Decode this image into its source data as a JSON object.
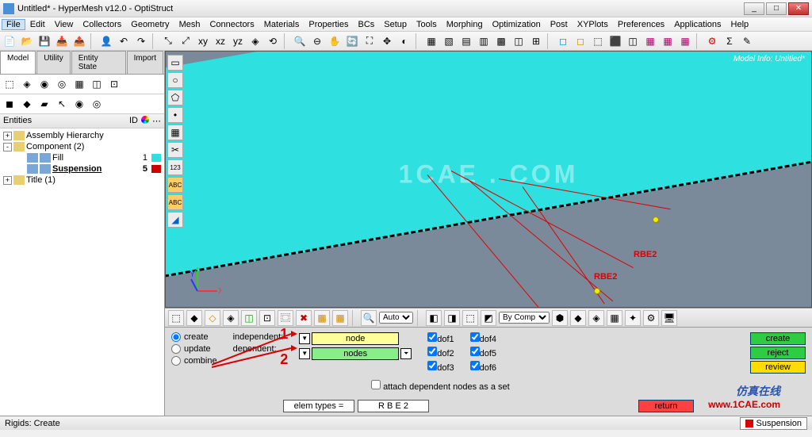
{
  "window": {
    "title": "Untitled* - HyperMesh v12.0 - OptiStruct"
  },
  "menus": [
    "File",
    "Edit",
    "View",
    "Collectors",
    "Geometry",
    "Mesh",
    "Connectors",
    "Materials",
    "Properties",
    "BCs",
    "Setup",
    "Tools",
    "Morphing",
    "Optimization",
    "Post",
    "XYPlots",
    "Preferences",
    "Applications",
    "Help"
  ],
  "tabs": {
    "items": [
      "Model",
      "Utility",
      "Entity State",
      "Import"
    ],
    "active": 0
  },
  "tree": {
    "header": {
      "col1": "Entities",
      "col2": "ID"
    },
    "assembly": "Assembly Hierarchy",
    "component": "Component (2)",
    "fill": {
      "name": "Fill",
      "id": "1",
      "color": "#2ee0e0"
    },
    "suspension": {
      "name": "Suspension",
      "id": "5",
      "color": "#d00000"
    },
    "title": "Title (1)"
  },
  "viewport": {
    "modelinfo": "Model Info: Untitled*",
    "watermark": "1CAE . COM",
    "labels": {
      "rbe2a": "RBE2",
      "rbe2b": "RBE2"
    },
    "vpbar_auto": "Auto",
    "vpbar_bycomp": "By Comp"
  },
  "form": {
    "radios": {
      "create": "create",
      "update": "update",
      "combine": "combine"
    },
    "labels": {
      "independent": "independent:",
      "dependent": "dependent:"
    },
    "sel": {
      "node": "node",
      "nodes": "nodes"
    },
    "attach": "attach dependent nodes as a set",
    "dofs": {
      "d1": "dof1",
      "d2": "dof2",
      "d3": "dof3",
      "d4": "dof4",
      "d5": "dof5",
      "d6": "dof6"
    },
    "actions": {
      "create": "create",
      "reject": "reject",
      "review": "review",
      "return": "return"
    },
    "marks": {
      "one": "1",
      "two": "2"
    },
    "elemtypes": "elem types =",
    "elemval": "R B E 2"
  },
  "status": {
    "text": "Rigids:  Create",
    "comp": "Suspension"
  },
  "brand": {
    "cn": "仿真在线",
    "url": "www.1CAE.com"
  }
}
